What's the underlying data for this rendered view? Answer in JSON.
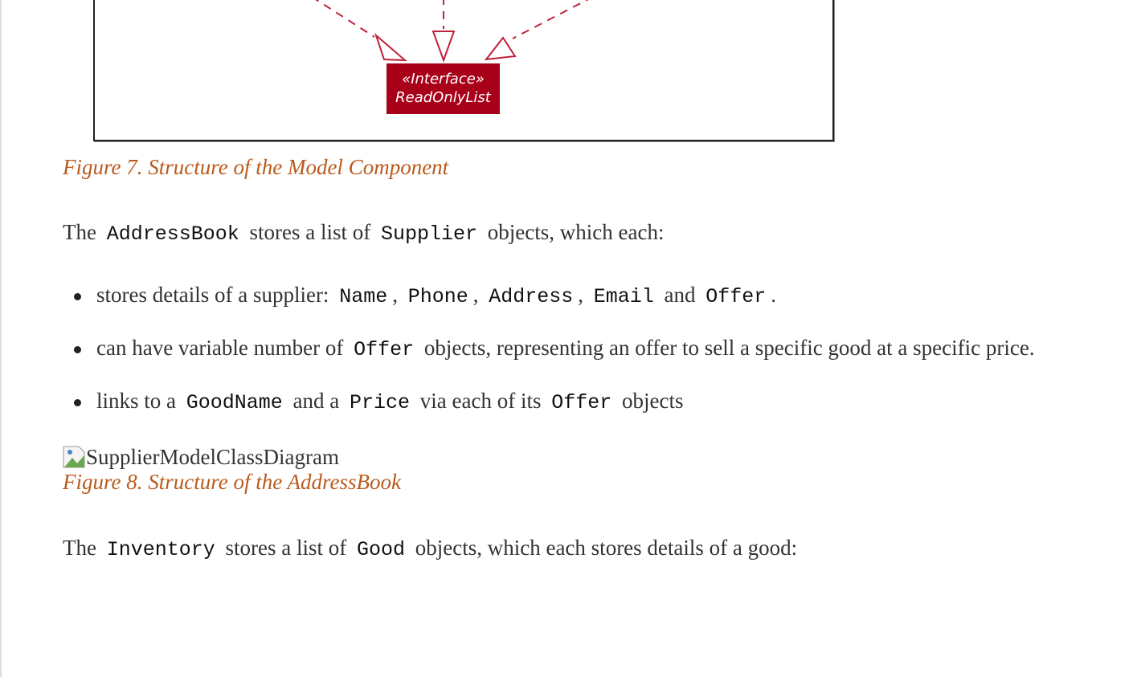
{
  "diagram": {
    "interface_stereotype": "«Interface»",
    "interface_name": "ReadOnlyList",
    "colors": {
      "box_fill": "#a80019",
      "arrow": "#c0203a"
    }
  },
  "figure7_caption": "Figure 7. Structure of the Model Component",
  "para1": {
    "t1": "The",
    "c1": "AddressBook",
    "t2": "stores a list of",
    "c2": "Supplier",
    "t3": "objects, which each:"
  },
  "bullets": [
    {
      "t1": "stores details of a supplier:",
      "c1": "Name",
      "t2": ",",
      "c2": "Phone",
      "t3": ",",
      "c3": "Address",
      "t4": ",",
      "c4": "Email",
      "t5": "and",
      "c5": "Offer",
      "t6": "."
    },
    {
      "t1": "can have variable number of",
      "c1": "Offer",
      "t2": "objects, representing an offer to sell a specific good at a specific price."
    },
    {
      "t1": "links to a",
      "c1": "GoodName",
      "t2": "and a",
      "c2": "Price",
      "t3": "via each of its",
      "c3": "Offer",
      "t4": "objects"
    }
  ],
  "figure8_image_alt": "SupplierModelClassDiagram",
  "figure8_caption": "Figure 8. Structure of the AddressBook",
  "para2": {
    "t1": "The",
    "c1": "Inventory",
    "t2": "stores a list of",
    "c2": "Good",
    "t3": "objects, which each stores details of a good:"
  },
  "icons": [
    "broken-image-icon",
    "bullet-dot-icon"
  ]
}
